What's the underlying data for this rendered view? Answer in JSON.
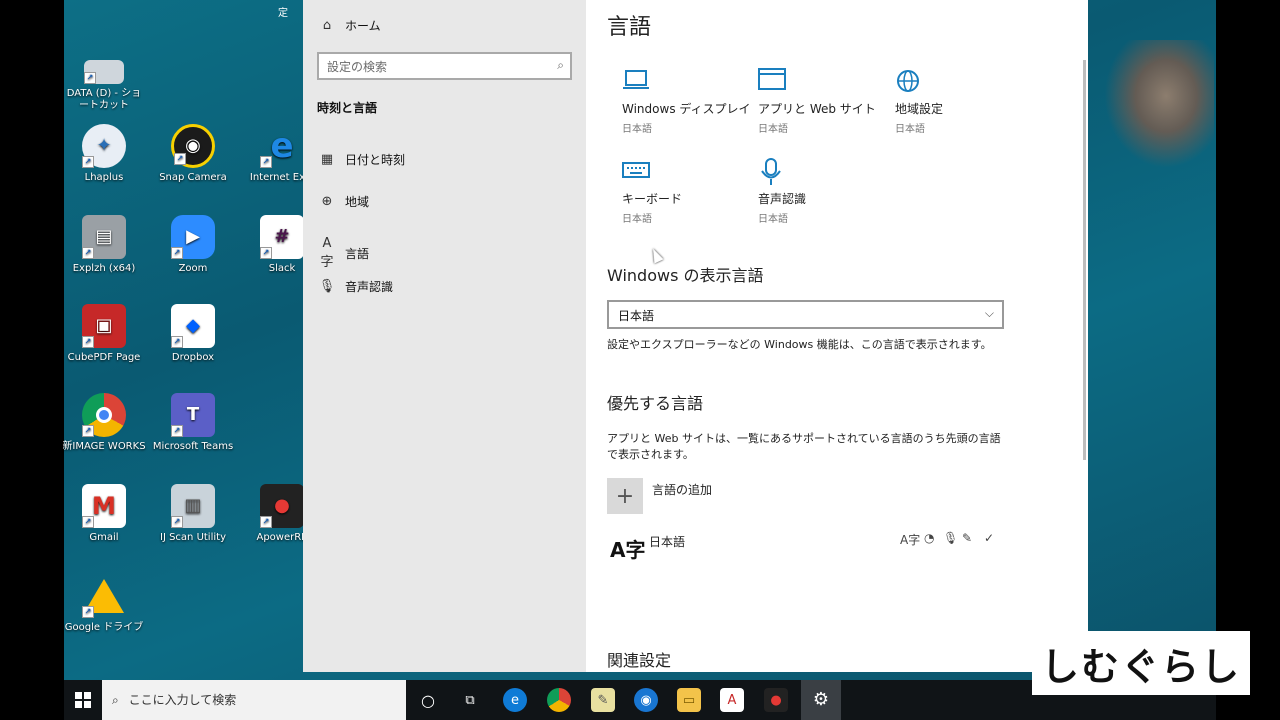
{
  "desktop": {
    "icons": [
      {
        "label": "DATA (D) - ショートカット",
        "color": "#cfd6dc"
      },
      {
        "label": "Lhaplus",
        "color": "#2a6fb6"
      },
      {
        "label": "Snap Camera",
        "color": "#1b1b1b"
      },
      {
        "label": "Internet Expl",
        "color": "#1e88e5"
      },
      {
        "label": "Explzh (x64)",
        "color": "#8a8f94"
      },
      {
        "label": "Zoom",
        "color": "#2d8cff"
      },
      {
        "label": "Slack",
        "color": "#ffffff"
      },
      {
        "label": "CubePDF Page",
        "color": "#c62828"
      },
      {
        "label": "Dropbox",
        "color": "#0061fe"
      },
      {
        "label": "新IMAGE WORKS",
        "color": "#4caf50"
      },
      {
        "label": "Microsoft Teams",
        "color": "#5b5fc7"
      },
      {
        "label": "Gmail",
        "color": "#ffffff"
      },
      {
        "label": "IJ Scan Utility",
        "color": "#7aa0b8"
      },
      {
        "label": "ApowerRE",
        "color": "#d32f2f"
      },
      {
        "label": "Google ドライブ",
        "color": "#ffffff"
      }
    ],
    "top_fragment": "定"
  },
  "settings": {
    "nav": {
      "home": "ホーム",
      "search_placeholder": "設定の検索",
      "section": "時刻と言語",
      "items": [
        {
          "label": "日付と時刻",
          "icon": "calendar-clock-icon"
        },
        {
          "label": "地域",
          "icon": "globe-icon"
        },
        {
          "label": "言語",
          "icon": "language-icon"
        },
        {
          "label": "音声認識",
          "icon": "microphone-icon"
        }
      ]
    },
    "main": {
      "title": "言語",
      "tiles": [
        {
          "label": "Windows ディスプレイ",
          "sub": "日本語",
          "icon": "laptop-icon"
        },
        {
          "label": "アプリと Web サイト",
          "sub": "日本語",
          "icon": "window-icon"
        },
        {
          "label": "地域設定",
          "sub": "日本語",
          "icon": "globe-icon"
        },
        {
          "label": "キーボード",
          "sub": "日本語",
          "icon": "keyboard-icon"
        },
        {
          "label": "音声認識",
          "sub": "日本語",
          "icon": "microphone-icon"
        }
      ],
      "display_lang_heading": "Windows の表示言語",
      "display_lang_value": "日本語",
      "display_lang_desc": "設定やエクスプローラーなどの Windows 機能は、この言語で表示されます。",
      "preferred_heading": "優先する言語",
      "preferred_desc": "アプリと Web サイトは、一覧にあるサポートされている言語のうち先頭の言語で表示されます。",
      "add_language": "言語の追加",
      "lang_glyph": "A字",
      "language_entry": "日本語",
      "related_heading": "関連設定"
    }
  },
  "taskbar": {
    "search_placeholder": "ここに入力して検索"
  },
  "watermark": "しむぐらし"
}
